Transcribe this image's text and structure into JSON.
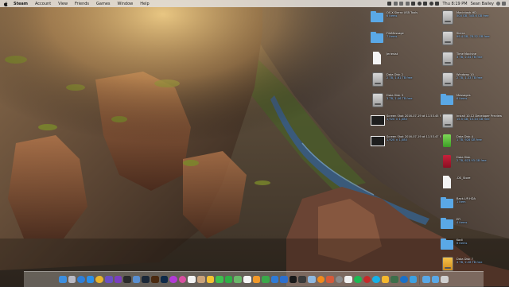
{
  "menubar": {
    "apple_icon": "apple-icon",
    "app_name": "Steam",
    "menus": [
      "Account",
      "View",
      "Friends",
      "Games",
      "Window",
      "Help"
    ],
    "clock": "Thu 8:19 PM",
    "user": "Sean Bailey"
  },
  "desktop_icons_left": [
    {
      "name": "OS X Sierra USB Tools",
      "meta": "6 items",
      "icon": "folder-icon"
    },
    {
      "name": "FileMessage",
      "meta": "7 items",
      "icon": "folder-icon"
    },
    {
      "name": "Jeriesist",
      "meta": "",
      "icon": "document-icon"
    },
    {
      "name": "Data Disk 2",
      "meta": "2 TB, 1.61 TB free",
      "icon": "disk-icon"
    },
    {
      "name": "Data Disk 3",
      "meta": "3 TB, 1.46 TB free",
      "icon": "disk-icon"
    },
    {
      "name": "Screen Shot 2016-07-19 at 11.53.45 PM",
      "meta": "1,920 × 1,080",
      "icon": "screenshot-icon"
    },
    {
      "name": "Screen Shot 2016-07-19 at 11.53.47 PM",
      "meta": "1,920 × 1,080",
      "icon": "screenshot-icon"
    }
  ],
  "desktop_icons_right": [
    {
      "name": "Macintosh HD",
      "meta": "500 GB, 345.6 GB free",
      "icon": "disk-icon"
    },
    {
      "name": "Sierra",
      "meta": "99.4 GB, 78.52 GB free",
      "icon": "disk-icon"
    },
    {
      "name": "Time Machine",
      "meta": "3 TB, 2.34 TB free",
      "icon": "disk-icon"
    },
    {
      "name": "Windows 10",
      "meta": "2 TB, 1.33 TB free",
      "icon": "disk-icon"
    },
    {
      "name": "Messages",
      "meta": "6 items",
      "icon": "folder-icon"
    },
    {
      "name": "Install 10.12 Developer Preview",
      "meta": "15.5 GB, 15.43 GB free",
      "icon": "disk-icon"
    },
    {
      "name": "Data Disk 4",
      "meta": "1 TB, 928 GB free",
      "icon": "green-disk-icon"
    },
    {
      "name": "Data Disk",
      "meta": "2 TB, 623.93 GB free",
      "icon": "red-disk-icon"
    },
    {
      "name": ".DS_Store",
      "meta": "",
      "icon": "document-icon"
    },
    {
      "name": "Back-UP-HDA",
      "meta": "1 item",
      "icon": "folder-icon"
    },
    {
      "name": "EFI",
      "meta": "4 items",
      "icon": "folder-icon"
    },
    {
      "name": "Kodi",
      "meta": "6 items",
      "icon": "folder-icon"
    },
    {
      "name": "Data Disk 7",
      "meta": "4 TB, 2.28 TB free",
      "icon": "disk-icon"
    }
  ],
  "dock": {
    "apps": [
      {
        "icon": "finder-icon",
        "color": "#3d8fe0"
      },
      {
        "icon": "launchpad-icon",
        "color": "#b9b9c4"
      },
      {
        "icon": "safari-icon",
        "color": "#2f7fd8"
      },
      {
        "icon": "app-store-icon",
        "color": "#2b8fe8"
      },
      {
        "icon": "chrome-icon",
        "color": "#e8b42c"
      },
      {
        "icon": "notes-icon",
        "color": "#6a4fc4"
      },
      {
        "icon": "imovie-icon",
        "color": "#7b3fbf"
      },
      {
        "icon": "final-cut-icon",
        "color": "#2a2a2a"
      },
      {
        "icon": "mail-icon",
        "color": "#5a8fd0"
      },
      {
        "icon": "steam-icon",
        "color": "#1b2838"
      },
      {
        "icon": "illustrator-icon",
        "color": "#4a2a10"
      },
      {
        "icon": "photoshop-icon",
        "color": "#0e2a48"
      },
      {
        "icon": "music-icon",
        "color": "#b23ad6"
      },
      {
        "icon": "itunes-icon",
        "color": "#d94fa0"
      },
      {
        "icon": "calendar-icon",
        "color": "#f2f2f2"
      },
      {
        "icon": "contacts-icon",
        "color": "#c9a27a"
      },
      {
        "icon": "photos-icon",
        "color": "#f4c232"
      },
      {
        "icon": "messages-icon",
        "color": "#3fbf4f"
      },
      {
        "icon": "facetime-icon",
        "color": "#2eaf45"
      },
      {
        "icon": "maps-icon",
        "color": "#6ab86a"
      },
      {
        "icon": "reminders-icon",
        "color": "#f4f4f4"
      },
      {
        "icon": "pages-icon",
        "color": "#f19a2b"
      },
      {
        "icon": "numbers-icon",
        "color": "#3aa84a"
      },
      {
        "icon": "keynote-icon",
        "color": "#2f7bd6"
      },
      {
        "icon": "xcode-icon",
        "color": "#2d6fcc"
      },
      {
        "icon": "terminal-icon",
        "color": "#1a1a1a"
      },
      {
        "icon": "activity-monitor-icon",
        "color": "#3a3a3a"
      },
      {
        "icon": "preview-icon",
        "color": "#8fb8e0"
      },
      {
        "icon": "vlc-icon",
        "color": "#f08a1c"
      },
      {
        "icon": "handbrake-icon",
        "color": "#d45a3a"
      },
      {
        "icon": "system-preferences-icon",
        "color": "#8a8a8a"
      },
      {
        "icon": "textedit-icon",
        "color": "#f0f0f0"
      },
      {
        "icon": "spotify-icon",
        "color": "#1db954"
      },
      {
        "icon": "transmission-icon",
        "color": "#c52a2a"
      },
      {
        "icon": "kodi-icon",
        "color": "#17b2e7"
      },
      {
        "icon": "sketch-icon",
        "color": "#f5b82e"
      },
      {
        "icon": "atom-icon",
        "color": "#3d6e4a"
      },
      {
        "icon": "1password-icon",
        "color": "#1a70c8"
      },
      {
        "icon": "tweetbot-icon",
        "color": "#3da0e0"
      }
    ],
    "stacks": [
      {
        "icon": "downloads-stack-icon",
        "color": "#5aa8e6"
      },
      {
        "icon": "documents-stack-icon",
        "color": "#5aa8e6"
      },
      {
        "icon": "trash-icon",
        "color": "#d0d0d0"
      }
    ]
  }
}
